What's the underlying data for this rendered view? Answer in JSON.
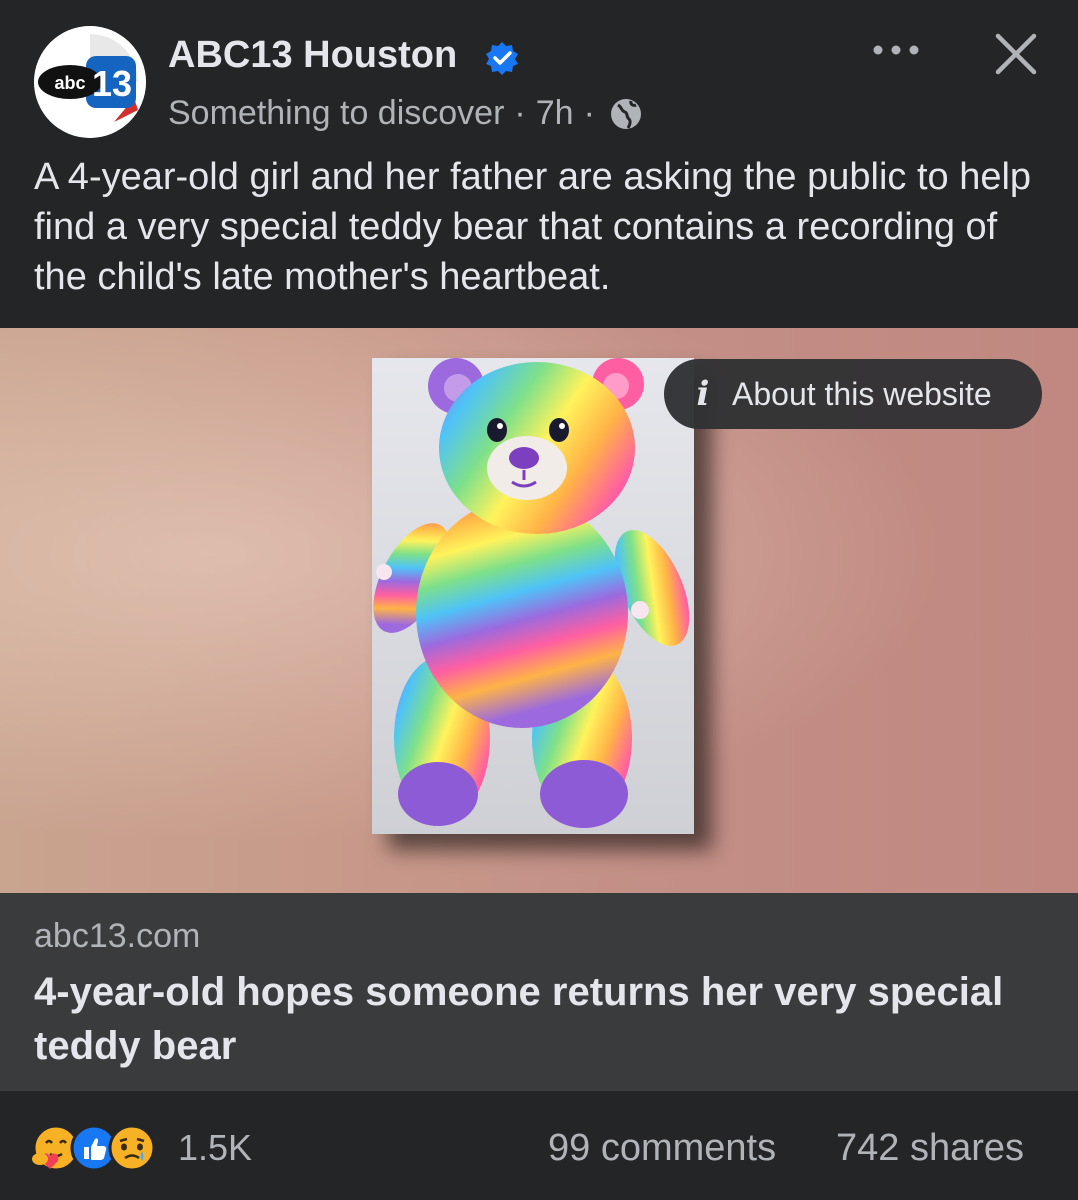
{
  "post": {
    "page_name": "ABC13 Houston",
    "avatar_logo_text": "abc13",
    "verified_icon": "verified-badge-icon",
    "audience_label": "Something to discover",
    "separator": "·",
    "time_ago": "7h",
    "privacy_icon": "globe-icon",
    "more_icon": "more-options-icon",
    "close_icon": "close-icon",
    "text": "A 4-year-old girl and her father are asking the public to help find a very special teddy bear that contains a recording of the child's late mother's heartbeat."
  },
  "media": {
    "about_label": "About this website",
    "about_icon": "info-icon"
  },
  "link_preview": {
    "domain": "abc13.com",
    "title": "4-year-old hopes someone returns her very special teddy bear"
  },
  "footer": {
    "reaction_icons": [
      "care-icon",
      "like-icon",
      "sad-icon"
    ],
    "reaction_count": "1.5K",
    "comments": "99 comments",
    "shares": "742 shares"
  },
  "colors": {
    "background": "#242526",
    "link_box": "#3a3b3c",
    "primary_text": "#e4e6eb",
    "secondary_text": "#b0b3b8",
    "verified_blue": "#1877f2",
    "abc_blue": "#1565c0"
  }
}
